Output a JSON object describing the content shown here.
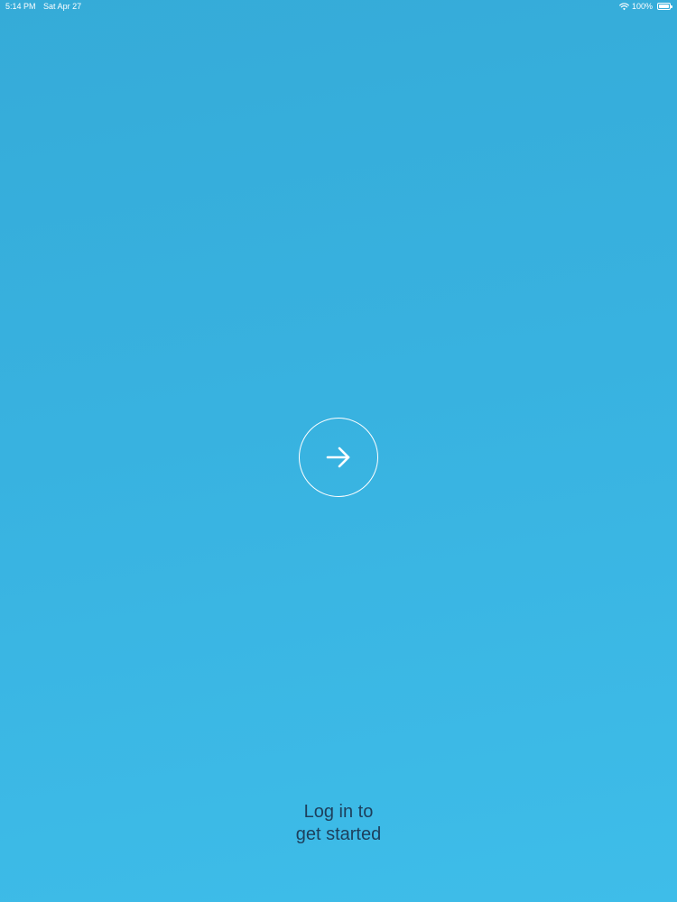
{
  "status_bar": {
    "time": "5:14 PM",
    "date": "Sat Apr 27",
    "battery_percent": "100%",
    "battery_level": 1.0,
    "wifi_icon": "wifi-icon",
    "battery_icon": "battery-icon"
  },
  "login": {
    "button_icon": "arrow-right-icon",
    "caption_line1": "Log in to",
    "caption_line2": "get started"
  },
  "colors": {
    "background_top": "#35abd8",
    "background_bottom": "#3ebde9",
    "caption_text": "#1d3f5c",
    "icon": "#ffffff"
  }
}
